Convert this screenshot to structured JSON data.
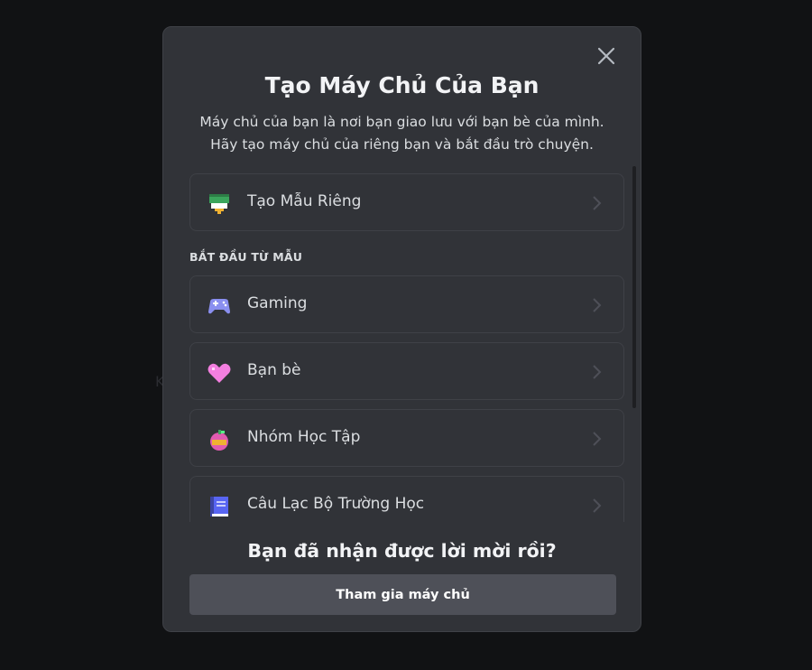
{
  "background": {
    "partial_text": "K"
  },
  "modal": {
    "title": "Tạo Máy Chủ Của Bạn",
    "subtitle_line1": "Máy chủ của bạn là nơi bạn giao lưu với bạn bè của mình.",
    "subtitle_line2": "Hãy tạo máy chủ của riêng bạn và bắt đầu trò chuyện.",
    "close_icon": "close-icon",
    "create_own": {
      "label": "Tạo Mẫu Riêng",
      "icon": "create-template-icon"
    },
    "section_header": "BẮT ĐẦU TỪ MẪU",
    "templates": [
      {
        "label": "Gaming",
        "icon": "gamepad-icon"
      },
      {
        "label": "Bạn bè",
        "icon": "heart-icon"
      },
      {
        "label": "Nhóm Học Tập",
        "icon": "apple-icon"
      },
      {
        "label": "Câu Lạc Bộ Trường Học",
        "icon": "book-icon"
      }
    ],
    "footer_title": "Bạn đã nhận được lời mời rồi?",
    "join_button": "Tham gia máy chủ"
  },
  "colors": {
    "backdrop": "#111214",
    "modal_bg": "#313338",
    "border": "#3f4147",
    "button_bg": "#4e5058",
    "text_primary": "#f2f3f5",
    "text_secondary": "#dbdee1"
  }
}
